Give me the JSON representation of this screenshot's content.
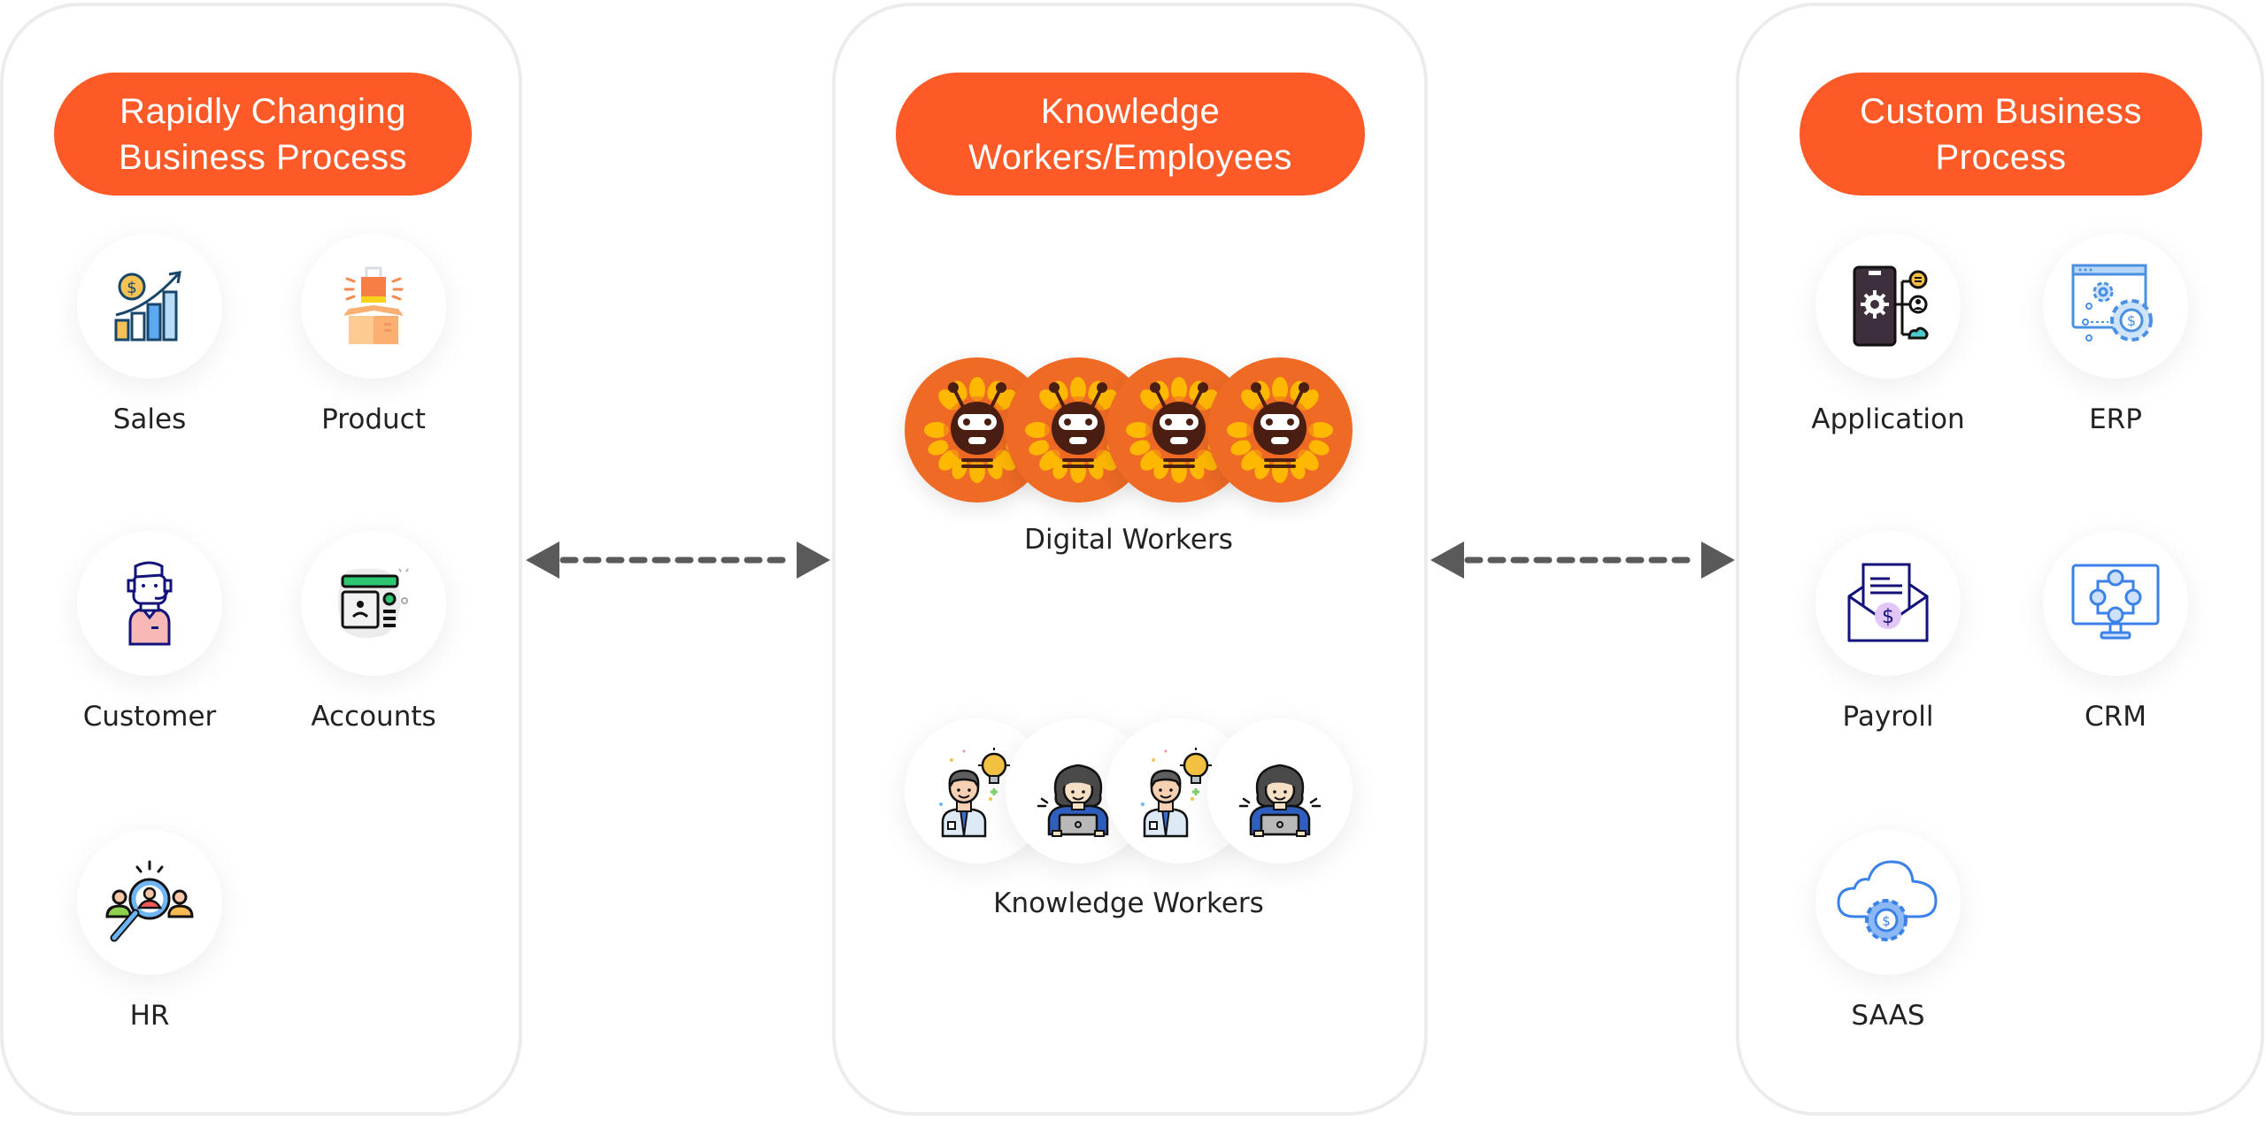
{
  "columns": {
    "left": {
      "title": "Rapidly Changing\nBusiness Process",
      "items": [
        {
          "label": "Sales",
          "icon": "sales-growth-icon"
        },
        {
          "label": "Product",
          "icon": "product-box-icon"
        },
        {
          "label": "Customer",
          "icon": "customer-support-icon"
        },
        {
          "label": "Accounts",
          "icon": "accounts-id-card-icon"
        },
        {
          "label": "HR",
          "icon": "hr-search-people-icon"
        }
      ]
    },
    "middle": {
      "title": "Knowledge\nWorkers/Employees",
      "groups": [
        {
          "label": "Digital Workers",
          "icon": "robot-icon",
          "count": 4
        },
        {
          "label": "Knowledge Workers",
          "icon": "person-icon",
          "count": 4
        }
      ]
    },
    "right": {
      "title": "Custom Business\nProcess",
      "items": [
        {
          "label": "Application",
          "icon": "mobile-app-icon"
        },
        {
          "label": "ERP",
          "icon": "erp-gear-icon"
        },
        {
          "label": "Payroll",
          "icon": "payroll-envelope-icon"
        },
        {
          "label": "CRM",
          "icon": "crm-monitor-icon"
        },
        {
          "label": "SAAS",
          "icon": "saas-cloud-icon"
        }
      ]
    }
  },
  "connectors": [
    {
      "from": "left",
      "to": "middle",
      "style": "dashed-bidirectional"
    },
    {
      "from": "middle",
      "to": "right",
      "style": "dashed-bidirectional"
    }
  ],
  "colors": {
    "accent": "#fd5a28",
    "robot_bg": "#ee6a25",
    "arrow": "#5a5a5a",
    "panel_border": "#ececec",
    "label_text": "#222222"
  }
}
